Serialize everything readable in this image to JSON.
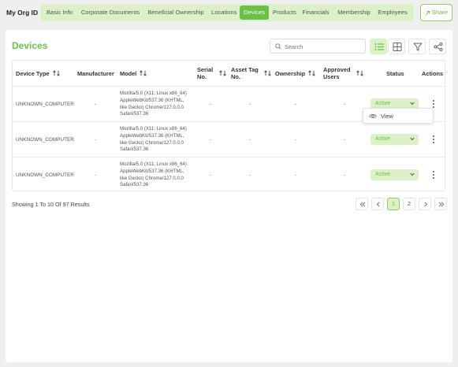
{
  "org_title": "My Org ID",
  "tabs": [
    {
      "label": "Basic Info"
    },
    {
      "label": "Corporate Documents"
    },
    {
      "label": "Beneficial Ownership"
    },
    {
      "label": "Locations"
    },
    {
      "label": "Devices",
      "active": true
    },
    {
      "label": "Products"
    },
    {
      "label": "Financials"
    },
    {
      "label": "Membership"
    },
    {
      "label": "Employees"
    }
  ],
  "share_label": "Share",
  "page_title": "Devices",
  "search": {
    "placeholder": "Search",
    "value": ""
  },
  "toolbar_icons": [
    "list-view-icon",
    "grid-view-icon",
    "filter-icon",
    "share-nodes-icon"
  ],
  "columns": {
    "device_type": "Device Type",
    "manufacturer": "Manufacturer",
    "model": "Model",
    "serial_no": "Serial No.",
    "asset_tag_no": "Asset Tag No.",
    "ownership": "Ownership",
    "approved_users": "Approved Users",
    "status": "Status",
    "actions": "Actions"
  },
  "rows": [
    {
      "device_type": "UNKNOWN_COMPUTER",
      "manufacturer": "-",
      "model": "Mozilla/5.0 (X11; Linux x86_64) AppleWebKit/537.36 (KHTML, like Gecko) Chrome/127.0.0.0 Safari/537.36",
      "serial_no": "-",
      "asset_tag_no": "-",
      "ownership": "-",
      "approved_users": "-",
      "status": "Active"
    },
    {
      "device_type": "UNKNOWN_COMPUTER",
      "manufacturer": "-",
      "model": "Mozilla/5.0 (X11; Linux x86_64) AppleWebKit/537.36 (KHTML, like Gecko) Chrome/127.0.0.0 Safari/537.36",
      "serial_no": "-",
      "asset_tag_no": "-",
      "ownership": "-",
      "approved_users": "-",
      "status": "Active"
    },
    {
      "device_type": "UNKNOWN_COMPUTER",
      "manufacturer": "-",
      "model": "Mozilla/5.0 (X11; Linux x86_64) AppleWebKit/537.36 (KHTML, like Gecko) Chrome/127.0.0.0 Safari/537.36",
      "serial_no": "-",
      "asset_tag_no": "-",
      "ownership": "-",
      "approved_users": "-",
      "status": "Active"
    }
  ],
  "row_menu": {
    "view_label": "View"
  },
  "results_text": "Showing 1 To 10 Of 97 Results",
  "pagination": {
    "pages": [
      "1",
      "2"
    ],
    "current": "1"
  },
  "colors": {
    "accent": "#6cbf47",
    "accent_light": "#ddf1c9",
    "background": "#efefef"
  }
}
